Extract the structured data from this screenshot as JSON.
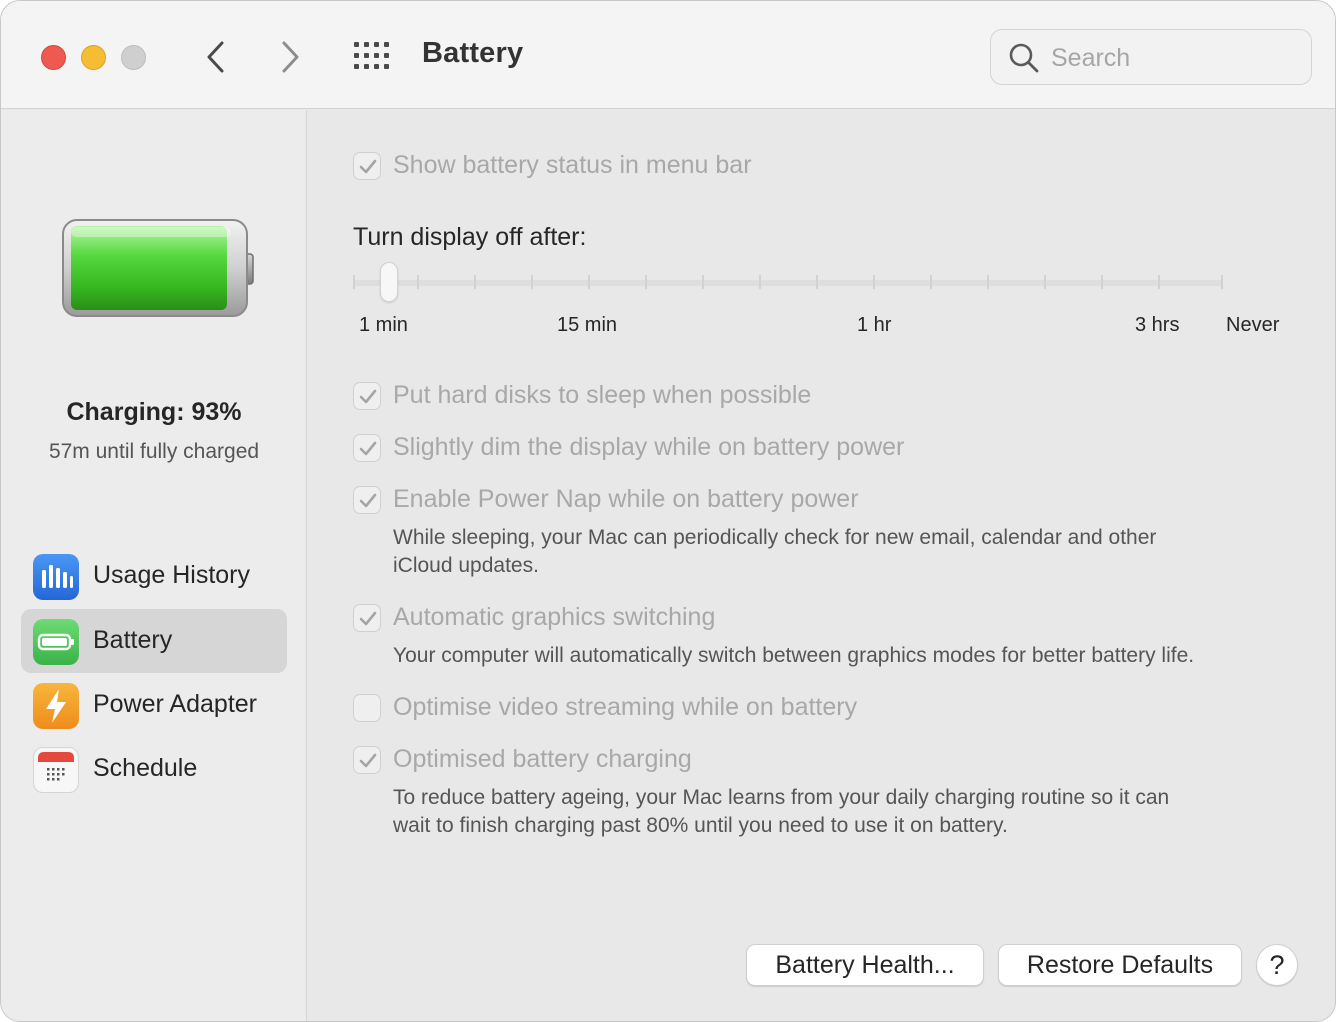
{
  "window": {
    "title": "Battery",
    "search": {
      "placeholder": "Search",
      "value": ""
    }
  },
  "sidebar": {
    "status_title": "Charging: 93%",
    "status_subtitle": "57m until fully charged",
    "battery_level_percent": 93,
    "items": [
      {
        "label": "Usage History",
        "icon": "bar-chart-icon",
        "color": "#2f7de1",
        "selected": false
      },
      {
        "label": "Battery",
        "icon": "battery-icon",
        "color": "#4cc95a",
        "selected": true
      },
      {
        "label": "Power Adapter",
        "icon": "lightning-bolt-icon",
        "color": "#f0a324",
        "selected": false
      },
      {
        "label": "Schedule",
        "icon": "calendar-icon",
        "color": "#e5483c",
        "selected": false
      }
    ]
  },
  "main": {
    "show_status": {
      "label": "Show battery status in menu bar",
      "checked": true
    },
    "display_off": {
      "heading": "Turn display off after:",
      "tick_labels": [
        "1 min",
        "15 min",
        "1 hr",
        "3 hrs",
        "Never"
      ],
      "value": "1 min"
    },
    "options": [
      {
        "label": "Put hard disks to sleep when possible",
        "checked": true,
        "description": ""
      },
      {
        "label": "Slightly dim the display while on battery power",
        "checked": true,
        "description": ""
      },
      {
        "label": "Enable Power Nap while on battery power",
        "checked": true,
        "description_lines": [
          "While sleeping, your Mac can periodically check for new email, calendar and other",
          "iCloud updates."
        ]
      },
      {
        "label": "Automatic graphics switching",
        "checked": true,
        "description_lines": [
          "Your computer will automatically switch between graphics modes for better battery life."
        ]
      },
      {
        "label": "Optimise video streaming while on battery",
        "checked": false,
        "description": ""
      },
      {
        "label": "Optimised battery charging",
        "checked": true,
        "description_lines": [
          "To reduce battery ageing, your Mac learns from your daily charging routine so it can",
          "wait to finish charging past 80% until you need to use it on battery."
        ]
      }
    ],
    "buttons": {
      "battery_health": "Battery Health...",
      "restore_defaults": "Restore Defaults",
      "help": "?"
    }
  },
  "colors": {
    "close": "#ee5a52",
    "minimize": "#f5bd33",
    "zoom_disabled": "#cfcfcf",
    "battery_fill": "#4cc95a"
  }
}
